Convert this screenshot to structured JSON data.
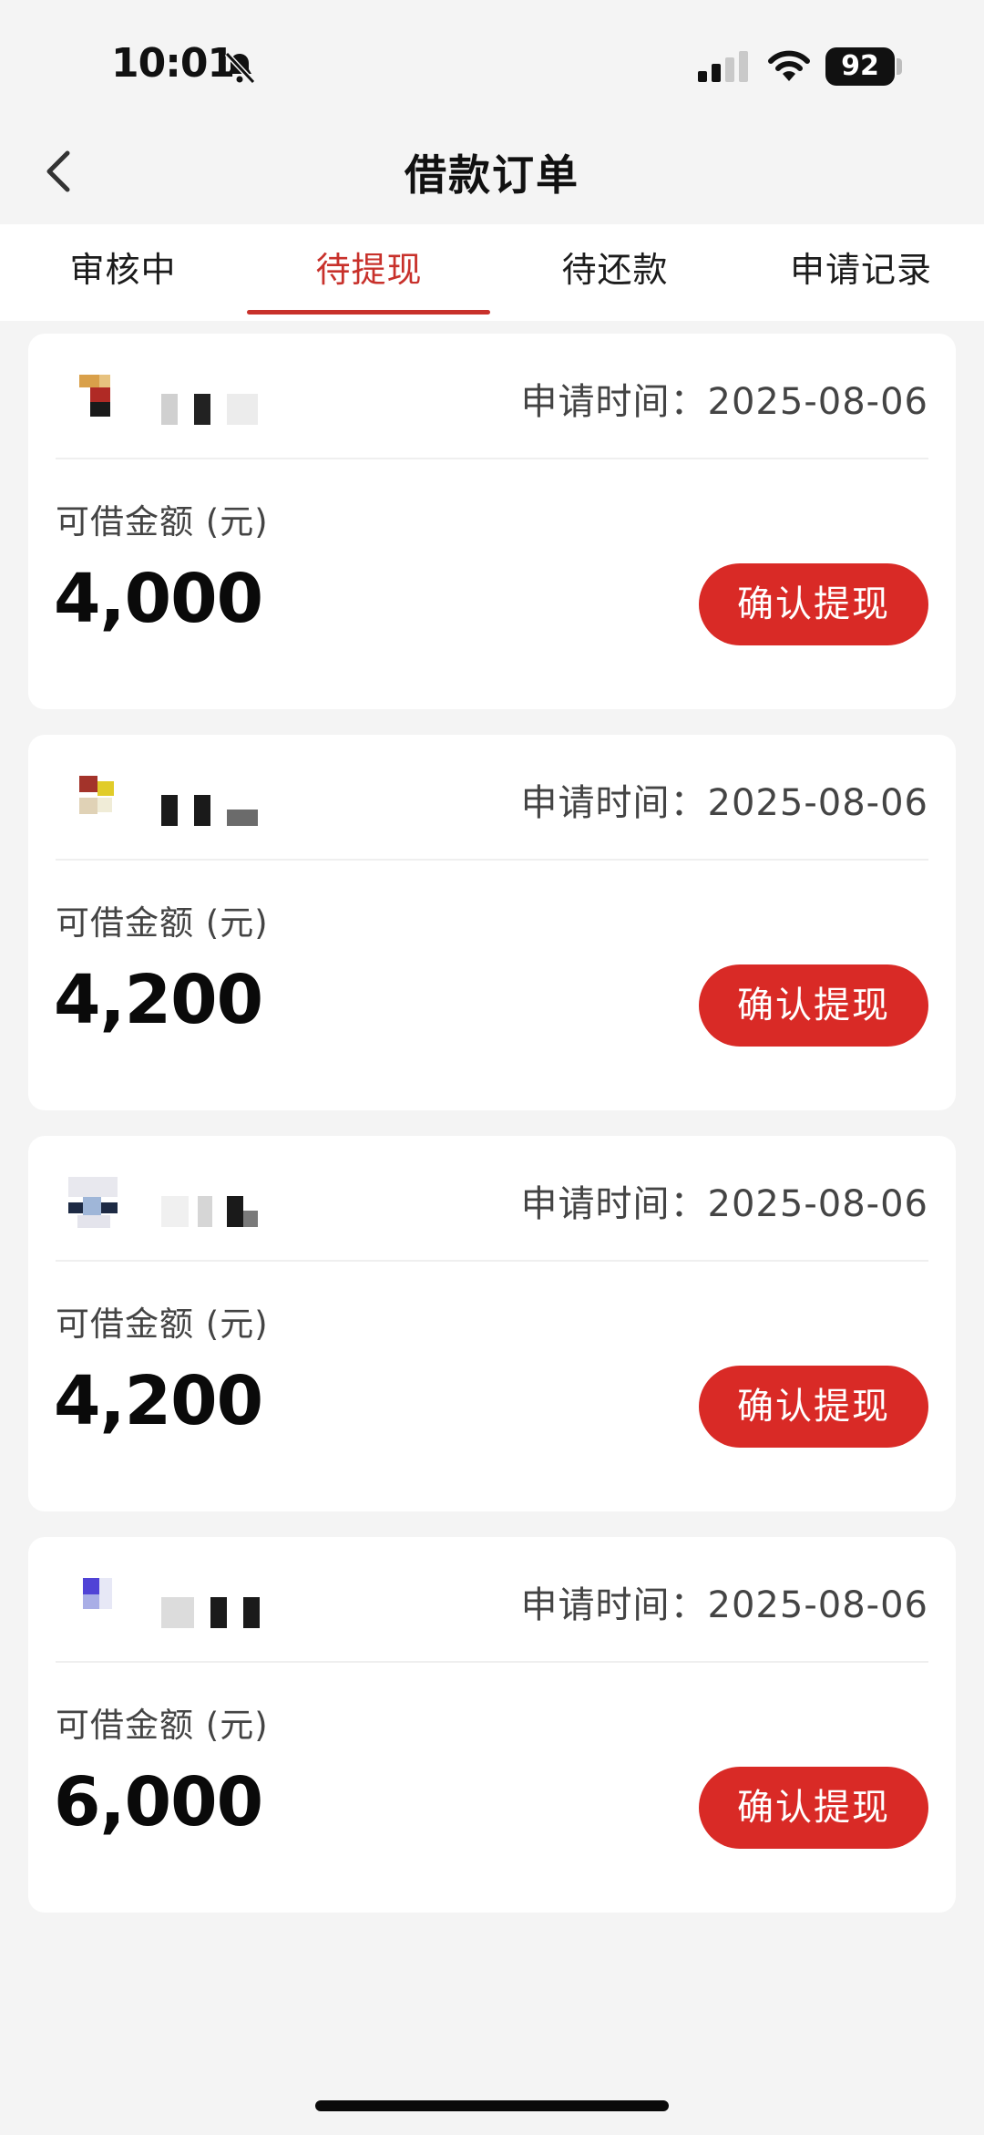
{
  "status_bar": {
    "time": "10:01",
    "battery": "92"
  },
  "nav": {
    "title": "借款订单"
  },
  "tabs": [
    {
      "label": "审核中",
      "active": false
    },
    {
      "label": "待提现",
      "active": true
    },
    {
      "label": "待还款",
      "active": false
    },
    {
      "label": "申请记录",
      "active": false
    }
  ],
  "orders": [
    {
      "apply_time": "申请时间：2025-08-06",
      "amount_label": "可借金额 (元)",
      "amount": "4,000",
      "button_label": "确认提现"
    },
    {
      "apply_time": "申请时间：2025-08-06",
      "amount_label": "可借金额 (元)",
      "amount": "4,200",
      "button_label": "确认提现"
    },
    {
      "apply_time": "申请时间：2025-08-06",
      "amount_label": "可借金额 (元)",
      "amount": "4,200",
      "button_label": "确认提现"
    },
    {
      "apply_time": "申请时间：2025-08-06",
      "amount_label": "可借金额 (元)",
      "amount": "6,000",
      "button_label": "确认提现"
    }
  ],
  "colors": {
    "accent": "#c8312b",
    "button": "#d92a26",
    "background": "#f4f4f4"
  },
  "icons": [
    "bell-muted-icon",
    "cellular-signal-icon",
    "wifi-icon",
    "battery-icon",
    "back-chevron-icon"
  ]
}
